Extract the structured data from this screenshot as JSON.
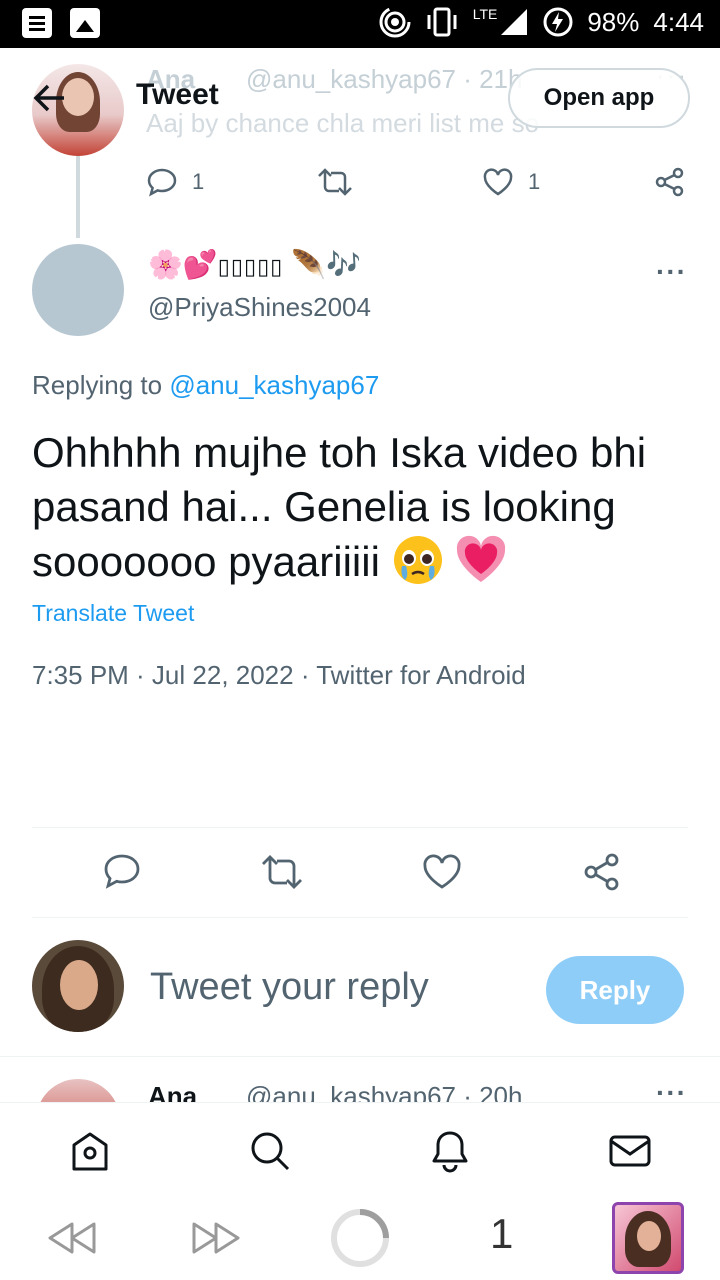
{
  "status_bar": {
    "battery": "98%",
    "time": "4:44",
    "network": "LTE"
  },
  "header": {
    "title": "Tweet",
    "open_app": "Open app"
  },
  "parent_tweet": {
    "name": "Ana",
    "handle_time": "@anu_kashyap67 · 21h",
    "text": "Aaj by chance chla meri list me so",
    "reply_count": "1",
    "like_count": "1"
  },
  "tweet": {
    "display_name_text": "▯▯▯▯▯",
    "handle": "@PriyaShines2004",
    "replying_prefix": "Replying to ",
    "replying_to": "@anu_kashyap67",
    "body": "Ohhhhh mujhe toh Iska video bhi pasand hai... Genelia is looking sooooooo pyaariiiii",
    "translate": "Translate Tweet",
    "timestamp": "7:35 PM · Jul 22, 2022 · Twitter for Android"
  },
  "composer": {
    "placeholder": "Tweet your reply",
    "reply_button": "Reply"
  },
  "next_reply": {
    "name": "Ana",
    "handle_time": "@anu_kashyap67 · 20h"
  },
  "browser": {
    "tab_count": "1"
  },
  "colors": {
    "accent": "#1d9bf0",
    "reply_button_disabled": "#8ecdf8",
    "secondary_text": "#536471"
  }
}
